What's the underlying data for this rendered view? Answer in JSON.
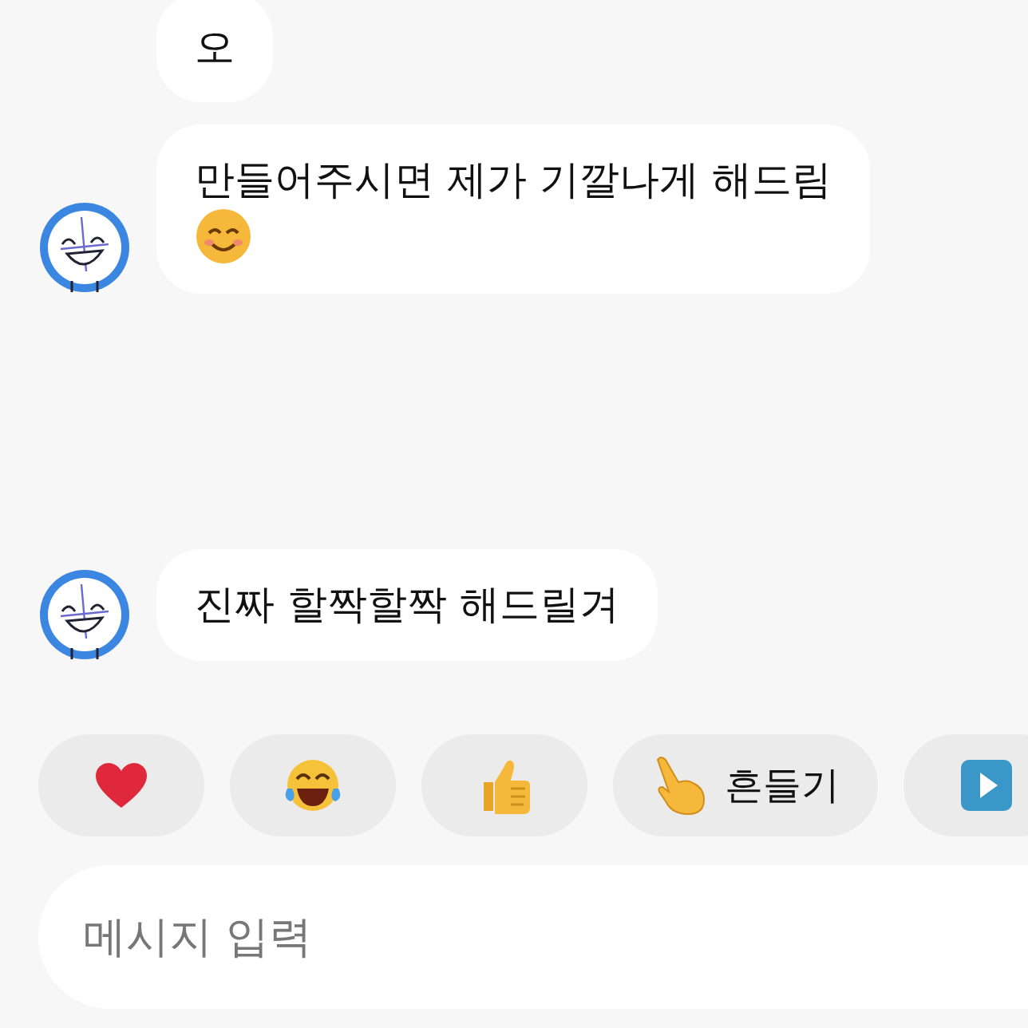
{
  "messages": [
    {
      "kind": "text",
      "text": "오",
      "avatar": false
    },
    {
      "kind": "text-with-smiley",
      "text": "만들어주시면 제가 기깔나게 해드림",
      "avatar": true
    },
    {
      "kind": "text",
      "text": "진짜 할짝할짝 해드릴겨",
      "avatar": true
    }
  ],
  "quick_replies": [
    {
      "kind": "heart"
    },
    {
      "kind": "laughing"
    },
    {
      "kind": "thumbs-up"
    },
    {
      "kind": "pointing",
      "label": "흔들기"
    },
    {
      "kind": "play"
    }
  ],
  "input": {
    "placeholder": "메시지 입력"
  }
}
